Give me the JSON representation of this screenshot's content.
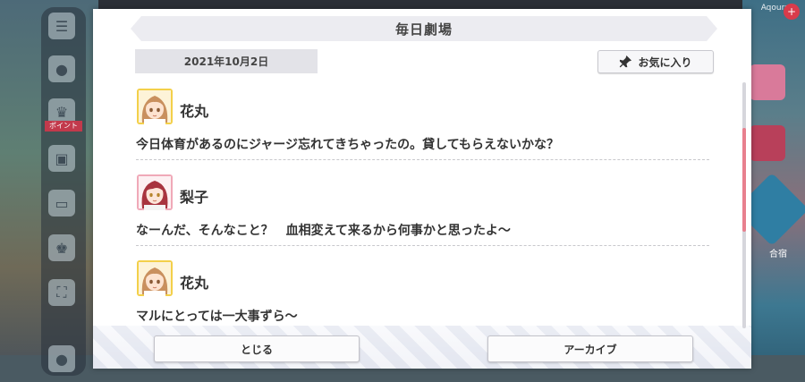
{
  "background": {
    "point_tag": "ポイント",
    "right_label": "合宿",
    "top_right_text": "Aqours"
  },
  "modal": {
    "title": "毎日劇場",
    "date": "2021年10月2日",
    "favorite_button": "お気に入り",
    "entries": [
      {
        "speaker": "花丸",
        "avatar": "hanamaru-avatar",
        "text": "今日体育があるのにジャージ忘れてきちゃったの。貸してもらえないかな？"
      },
      {
        "speaker": "梨子",
        "avatar": "riko-avatar",
        "text": "なーんだ、そんなこと？　血相変えて来るから何事かと思ったよ～"
      },
      {
        "speaker": "花丸",
        "avatar": "hanamaru-avatar",
        "text": "マルにとっては一大事ずら～"
      }
    ],
    "close_button": "とじる",
    "archive_button": "アーカイブ"
  },
  "colors": {
    "accent_scroll": "#e8808e",
    "hanamaru_frame": "#f3d04a",
    "riko_frame": "#f0a9b8"
  }
}
